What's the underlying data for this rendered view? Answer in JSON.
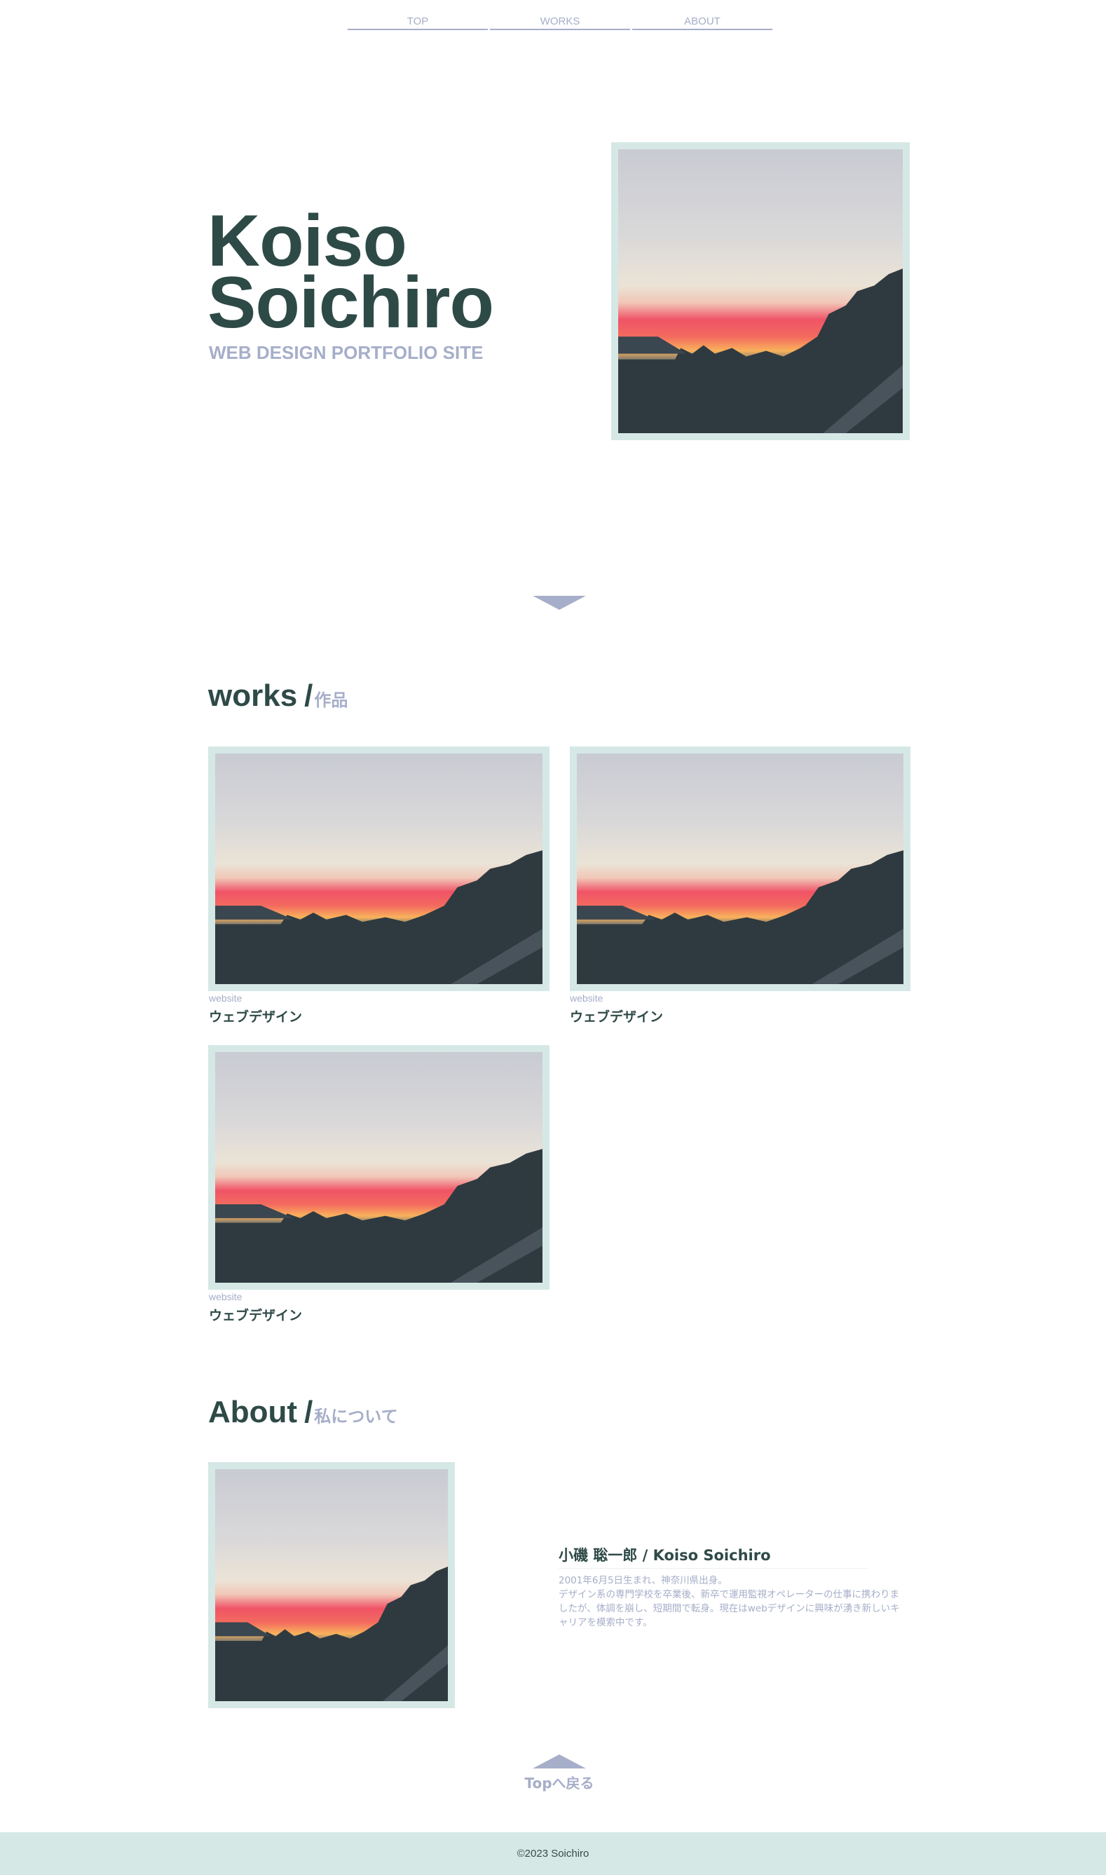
{
  "nav": {
    "items": [
      "TOP",
      "WORKS",
      "ABOUT"
    ]
  },
  "hero": {
    "title_line1": "Koiso",
    "title_line2": "Soichiro",
    "subtitle": "WEB DESIGN PORTFOLIO SITE",
    "scroll_icon": "chevron-down-icon"
  },
  "works": {
    "heading_en": "works",
    "slash": "/",
    "heading_jp": "作品",
    "items": [
      {
        "category": "website",
        "title": "ウェブデザイン"
      },
      {
        "category": "website",
        "title": "ウェブデザイン"
      },
      {
        "category": "website",
        "title": "ウェブデザイン"
      }
    ]
  },
  "about": {
    "heading_en": "About",
    "slash": "/",
    "heading_jp": "私について",
    "name": "小磯 聡一郎 / Koiso Soichiro",
    "body": "2001年6月5日生まれ、神奈川県出身。\nデザイン系の専門学校を卒業後、新卒で運用監視オペレーターの仕事に携わりましたが、体調を崩し、短期間で転身。現在はwebデザインに興味が湧き新しいキャリアを模索中です。"
  },
  "back_to_top": {
    "label": "Topへ戻る",
    "icon": "chevron-up-icon"
  },
  "footer": {
    "copyright": "©2023 Soichiro"
  },
  "colors": {
    "accent": "#a6aec9",
    "frame": "#d5e8e5",
    "text_dark": "#2e4a47"
  }
}
